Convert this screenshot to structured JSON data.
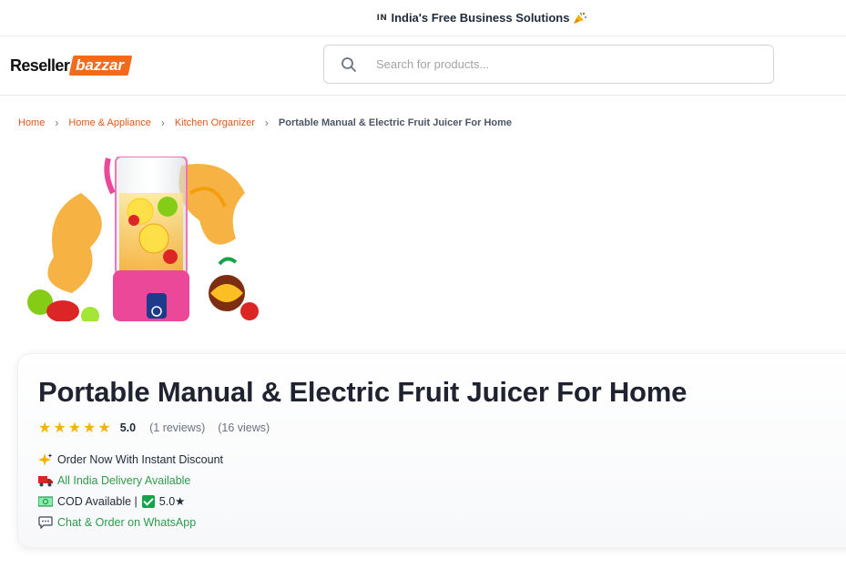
{
  "topbar": {
    "flag": "IN",
    "text": "India's Free Business Solutions",
    "party_icon": "party-popper-icon"
  },
  "logo": {
    "part1": "Reseller",
    "part2": "bazzar"
  },
  "search": {
    "placeholder": "Search for products...",
    "value": ""
  },
  "breadcrumb": {
    "items": [
      "Home",
      "Home & Appliance",
      "Kitchen Organizer"
    ],
    "current": "Portable Manual & Electric Fruit Juicer For Home"
  },
  "product": {
    "title": "Portable Manual & Electric Fruit Juicer For Home",
    "rating": {
      "stars": 5,
      "score": "5.0",
      "reviews": "(1 reviews)",
      "views": "(16 views)"
    },
    "features": {
      "offer": "Order Now With Instant Discount",
      "delivery": "All India Delivery Available",
      "cod": "COD Available |",
      "cod_rating": "5.0★",
      "whatsapp": "Chat & Order on WhatsApp"
    }
  },
  "colors": {
    "brand": "#f26b1d",
    "breadcrumb_link": "#e0561b",
    "green": "#2e9a4a",
    "star": "#f5b301"
  }
}
